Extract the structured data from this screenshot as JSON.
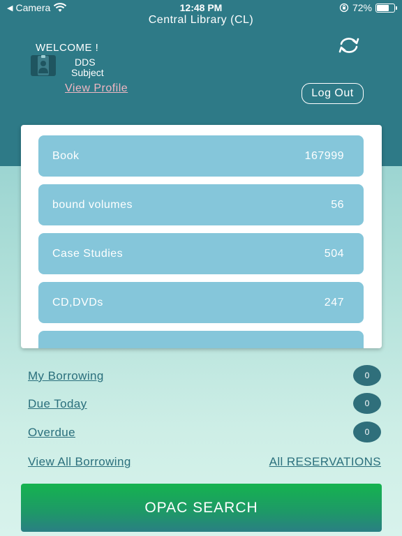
{
  "status_bar": {
    "back_label": "Camera",
    "time": "12:48 PM",
    "battery": "72%",
    "battery_level": 0.72
  },
  "header": {
    "title": "Central Library (CL)",
    "welcome": "WELCOME !",
    "user_line1": "DDS",
    "user_line2": "Subject",
    "view_profile": "View Profile",
    "logout": "Log Out"
  },
  "categories": [
    {
      "label": "Book",
      "count": "167999"
    },
    {
      "label": "bound volumes",
      "count": "56"
    },
    {
      "label": "Case Studies",
      "count": "504"
    },
    {
      "label": "CD,DVDs",
      "count": "247"
    },
    {
      "label": "",
      "count": ""
    }
  ],
  "borrowing": {
    "my_borrowing": {
      "label": "My Borrowing",
      "count": "0"
    },
    "due_today": {
      "label": "Due Today",
      "count": "0"
    },
    "overdue": {
      "label": "Overdue",
      "count": "0"
    },
    "view_all": "View All Borrowing",
    "all_reservations": "All RESERVATIONS"
  },
  "opac_button": "OPAC SEARCH",
  "colors": {
    "header": "#2e7a87",
    "category_bg": "#85c6da",
    "link": "#2a6f7c",
    "badge": "#2f6f7b",
    "opac_green": "#15b34f"
  }
}
